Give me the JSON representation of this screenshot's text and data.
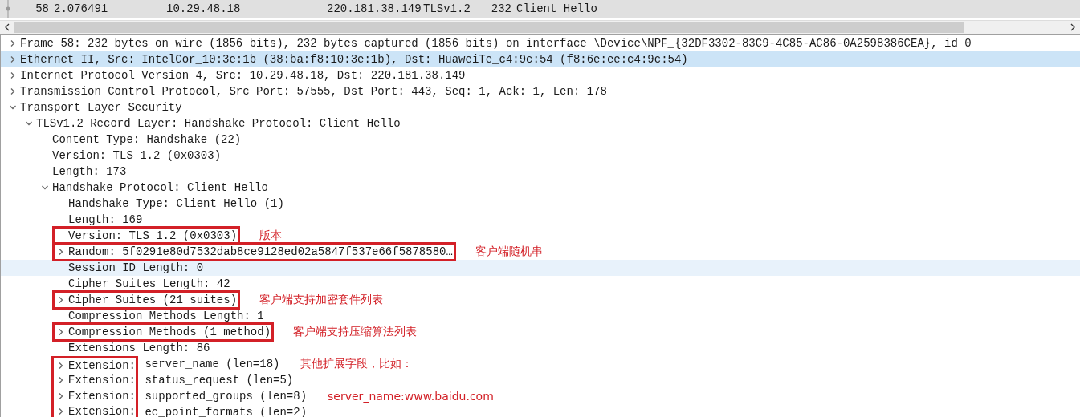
{
  "packet_list": {
    "rows": [
      {
        "no": "58",
        "time": "2.076491",
        "source": "10.29.48.18",
        "destination": "220.181.38.149",
        "protocol": "TLSv1.2",
        "length": "232",
        "info": "Client Hello",
        "selected": true
      }
    ]
  },
  "details": {
    "items": [
      {
        "text": "Frame 58: 232 bytes on wire (1856 bits), 232 bytes captured (1856 bits) on interface \\Device\\NPF_{32DF3302-83C9-4C85-AC86-0A2598386CEA}, id 0",
        "expanded": false,
        "selected": false
      },
      {
        "text": "Ethernet II, Src: IntelCor_10:3e:1b (38:ba:f8:10:3e:1b), Dst: HuaweiTe_c4:9c:54 (f8:6e:ee:c4:9c:54)",
        "expanded": false,
        "selected": true
      },
      {
        "text": "Internet Protocol Version 4, Src: 10.29.48.18, Dst: 220.181.38.149",
        "expanded": false,
        "selected": false
      },
      {
        "text": "Transmission Control Protocol, Src Port: 57555, Dst Port: 443, Seq: 1, Ack: 1, Len: 178",
        "expanded": false,
        "selected": false
      },
      {
        "text": "Transport Layer Security",
        "expanded": true,
        "selected": false,
        "children": [
          {
            "text": "TLSv1.2 Record Layer: Handshake Protocol: Client Hello",
            "expanded": true,
            "selected": false,
            "children": [
              {
                "text": "Content Type: Handshake (22)",
                "selected": false
              },
              {
                "text": "Version: TLS 1.2 (0x0303)",
                "selected": false
              },
              {
                "text": "Length: 173",
                "selected": false
              },
              {
                "text": "Handshake Protocol: Client Hello",
                "expanded": true,
                "selected": false,
                "children": [
                  {
                    "text": "Handshake Type: Client Hello (1)",
                    "selected": false
                  },
                  {
                    "text": "Length: 169",
                    "selected": false
                  },
                  {
                    "text": "Version: TLS 1.2 (0x0303)",
                    "selected": false,
                    "framed": true,
                    "note": "版本"
                  },
                  {
                    "text": "Random: 5f0291e80d7532dab8ce9128ed02a5847f537e66f5878580…",
                    "expanded": false,
                    "selected": false,
                    "framed": true,
                    "note": "客户端随机串"
                  },
                  {
                    "text": "Session ID Length: 0",
                    "selected": false,
                    "hovered": true
                  },
                  {
                    "text": "Cipher Suites Length: 42",
                    "selected": false
                  },
                  {
                    "text": "Cipher Suites (21 suites)",
                    "expanded": false,
                    "selected": false,
                    "framed": true,
                    "note": "客户端支持加密套件列表"
                  },
                  {
                    "text": "Compression Methods Length: 1",
                    "selected": false
                  },
                  {
                    "text": "Compression Methods (1 method)",
                    "expanded": false,
                    "selected": false,
                    "framed": true,
                    "note": "客户端支持压缩算法列表"
                  },
                  {
                    "text": "Extensions Length: 86",
                    "selected": false
                  },
                  {
                    "key": "Extension:",
                    "text": "server_name (len=18)",
                    "expanded": false,
                    "selected": false,
                    "key_framed": true,
                    "note": "其他扩展字段，比如："
                  },
                  {
                    "key": "Extension:",
                    "text": "status_request (len=5)",
                    "expanded": false,
                    "selected": false,
                    "key_framed": true
                  },
                  {
                    "key": "Extension:",
                    "text": "supported_groups (len=8)",
                    "expanded": false,
                    "selected": false,
                    "key_framed": true,
                    "note": "server_name:www.baidu.com"
                  },
                  {
                    "key": "Extension:",
                    "text": "ec_point_formats (len=2)",
                    "expanded": false,
                    "selected": false,
                    "key_framed": true
                  }
                ]
              }
            ]
          }
        ]
      }
    ]
  }
}
